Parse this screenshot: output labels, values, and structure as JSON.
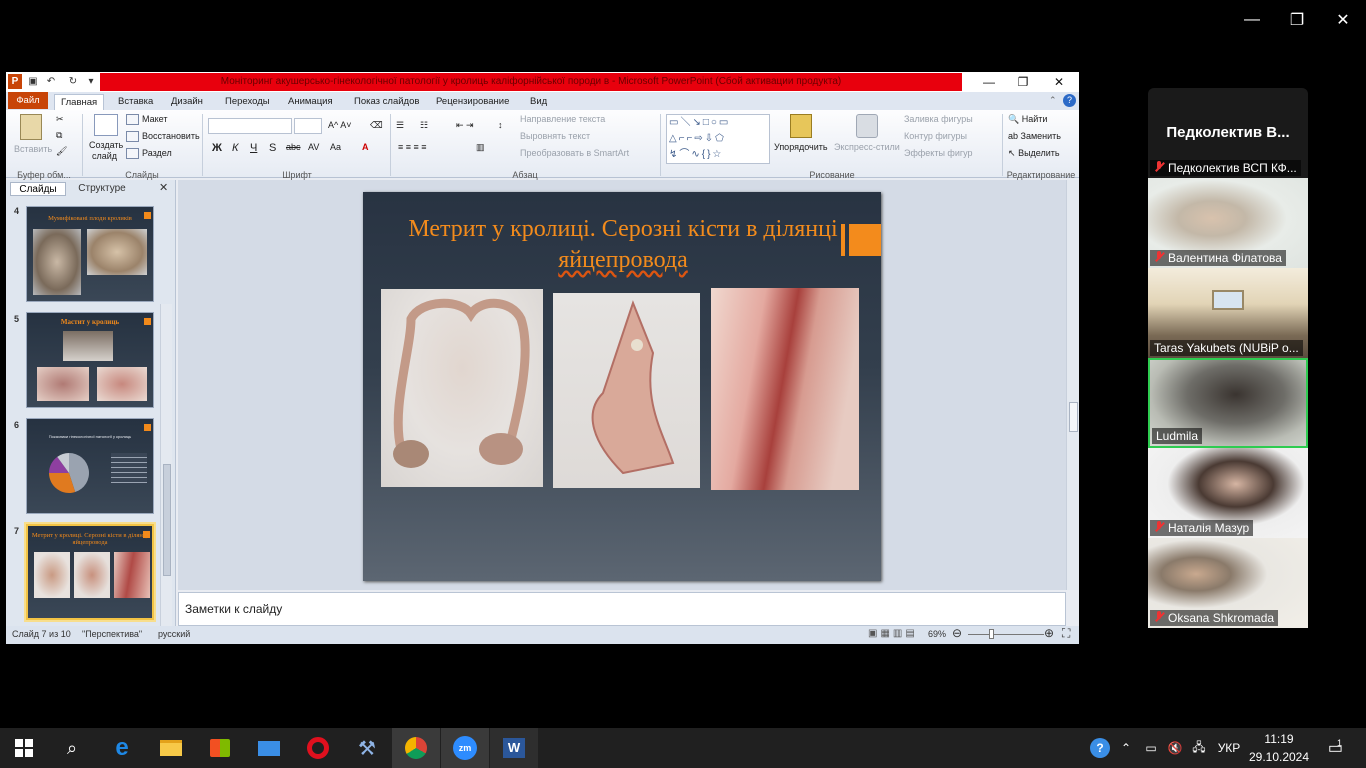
{
  "zoom_window": {
    "controls": [
      "—",
      "❐",
      "✕"
    ]
  },
  "ppt": {
    "title": "Моніторинг акушерсько-гінекологічної патології у кролиць каліфорнійської породи в  -  Microsoft PowerPoint (Сбой активации продукта)",
    "tabs": [
      "Файл",
      "Главная",
      "Вставка",
      "Дизайн",
      "Переходы",
      "Анимация",
      "Показ слайдов",
      "Рецензирование",
      "Вид"
    ],
    "groups": {
      "clipboard": "Буфер обм...",
      "slides": "Слайды",
      "font": "Шрифт",
      "paragraph": "Абзац",
      "drawing": "Рисование",
      "editing": "Редактирование"
    },
    "ribbon": {
      "paste": "Вставить",
      "create": "Создать",
      "slide": "слайд",
      "layout": "Макет",
      "reset": "Восстановить",
      "section": "Раздел",
      "text_dir": "Направление текста",
      "align_text": "Выровнять текст",
      "smartart": "Преобразовать в SmartArt",
      "arrange": "Упорядочить",
      "quick_styles": "Экспресс-стили",
      "fill": "Заливка фигуры",
      "outline": "Контур фигуры",
      "effects": "Эффекты фигур",
      "find": "Найти",
      "replace": "Заменить",
      "select": "Выделить"
    },
    "panel_tabs": [
      "Слайды",
      "Структуре"
    ],
    "thumbs": [
      {
        "num": "4",
        "title": "Мумифіковані плоди кроликів"
      },
      {
        "num": "5",
        "title": "Мастит у кролиць"
      },
      {
        "num": "6",
        "title": "Показники гінекологічної патології у кролиць"
      },
      {
        "num": "7",
        "title": "Метрит у кролиці. Серозні кісти в ділянці яйцепровода"
      }
    ],
    "slide": {
      "title_part1": "Метрит у кролиці. Серозні кісти в ділянці ",
      "title_part2": "яйцепровода"
    },
    "notes_placeholder": "Заметки к слайду",
    "status": {
      "slide_info": "Слайд 7 из 10",
      "theme": "\"Перспектива\"",
      "lang": "русский",
      "zoom": "69%"
    }
  },
  "participants": {
    "header": "Педколектив  В...",
    "tiles": [
      {
        "name": "Педколектив ВСП КФ...",
        "muted": true
      },
      {
        "name": "Валентина Філатова",
        "muted": true
      },
      {
        "name": "Taras Yakubets (NUBiP o...",
        "muted": false
      },
      {
        "name": "Ludmila",
        "muted": false
      },
      {
        "name": "Наталія Мазур",
        "muted": true
      },
      {
        "name": "Oksana Shkromada",
        "muted": true
      }
    ]
  },
  "taskbar": {
    "lang": "УКР",
    "time": "11:19",
    "date": "29.10.2024",
    "notifications": "1"
  },
  "chart_data": {
    "type": "pie",
    "values": [
      45,
      30,
      15,
      10
    ]
  }
}
